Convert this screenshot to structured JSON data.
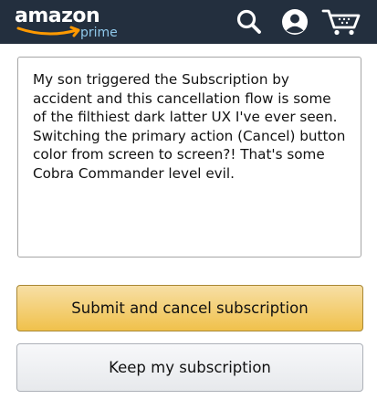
{
  "header": {
    "logo_text": "amazon",
    "logo_sub": "prime",
    "icons": [
      "search-icon",
      "account-icon",
      "cart-icon"
    ],
    "colors": {
      "bar": "#232f3e",
      "smile": "#ff9900",
      "prime": "#8fc8ea"
    }
  },
  "feedback": {
    "text": "My son triggered the Subscription by accident and this cancellation flow is some of the filthiest dark latter UX I've ever seen. Switching the primary action (Cancel) button color from screen to screen?! That's some Cobra Commander level evil."
  },
  "actions": {
    "submit_label": "Submit and cancel subscription",
    "keep_label": "Keep my subscription",
    "colors": {
      "primary": "#f0c14b",
      "secondary": "#e7e9ec"
    }
  }
}
